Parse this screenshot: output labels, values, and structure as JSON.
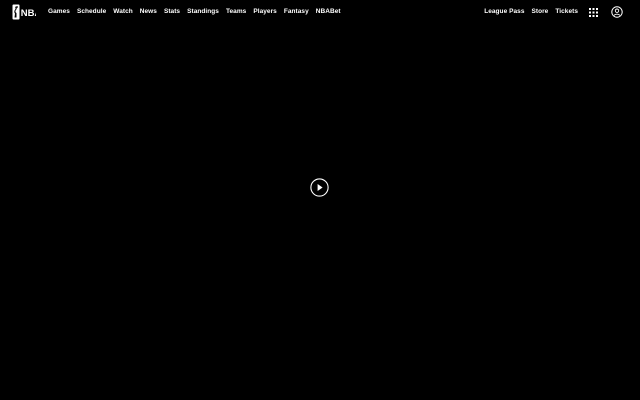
{
  "header": {
    "logo_text": "NBA",
    "nav": [
      {
        "label": "Games"
      },
      {
        "label": "Schedule"
      },
      {
        "label": "Watch"
      },
      {
        "label": "News"
      },
      {
        "label": "Stats"
      },
      {
        "label": "Standings"
      },
      {
        "label": "Teams"
      },
      {
        "label": "Players"
      },
      {
        "label": "Fantasy"
      },
      {
        "label": "NBABet"
      }
    ],
    "right_links": [
      {
        "label": "League Pass"
      },
      {
        "label": "Store"
      },
      {
        "label": "Tickets"
      }
    ],
    "icons": {
      "apps": "apps-grid-icon",
      "account": "user-account-icon"
    }
  },
  "video": {
    "play_icon": "play-icon"
  },
  "colors": {
    "background": "#000000",
    "text": "#ffffff"
  }
}
